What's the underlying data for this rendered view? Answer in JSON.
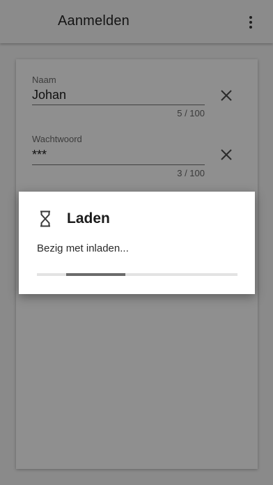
{
  "app_bar": {
    "title": "Aanmelden",
    "menu_icon": "more-vert-icon"
  },
  "form": {
    "fields": [
      {
        "label": "Naam",
        "value": "Johan",
        "counter": "5 / 100",
        "clear_icon": "close-icon"
      },
      {
        "label": "Wachtwoord",
        "value": "***",
        "counter": "3 / 100",
        "clear_icon": "close-icon"
      }
    ]
  },
  "dialog": {
    "icon": "hourglass-icon",
    "title": "Laden",
    "message": "Bezig met inladen...",
    "progress": {
      "start": 0.147,
      "end": 0.441
    }
  },
  "colors": {
    "scrim": "#8a8a8a",
    "dialog_bg": "#ffffff",
    "progress_track": "#e3e3e3",
    "progress_fill": "#6b6b6b"
  }
}
